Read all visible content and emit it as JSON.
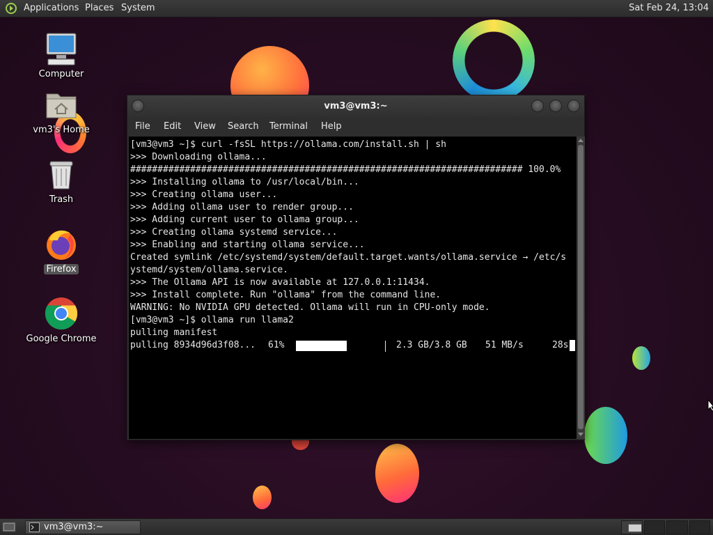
{
  "top_panel": {
    "menus": [
      "Applications",
      "Places",
      "System"
    ],
    "clock": "Sat Feb 24, 13:04"
  },
  "desktop_icons": [
    {
      "label": "Computer",
      "icon": "computer-icon"
    },
    {
      "label": "vm3's Home",
      "icon": "home-folder-icon"
    },
    {
      "label": "Trash",
      "icon": "trash-icon"
    },
    {
      "label": "Firefox",
      "icon": "firefox-icon"
    },
    {
      "label": "Google Chrome",
      "icon": "chrome-icon"
    }
  ],
  "terminal": {
    "title": "vm3@vm3:~",
    "menus": [
      "File",
      "Edit",
      "View",
      "Search",
      "Terminal",
      "Help"
    ],
    "lines": [
      "[vm3@vm3 ~]$ curl -fsSL https://ollama.com/install.sh | sh",
      ">>> Downloading ollama...",
      "######################################################################## 100.0%",
      ">>> Installing ollama to /usr/local/bin...",
      ">>> Creating ollama user...",
      ">>> Adding ollama user to render group...",
      ">>> Adding current user to ollama group...",
      ">>> Creating ollama systemd service...",
      ">>> Enabling and starting ollama service...",
      "Created symlink /etc/systemd/system/default.target.wants/ollama.service → /etc/s",
      "ystemd/system/ollama.service.",
      ">>> The Ollama API is now available at 127.0.0.1:11434.",
      ">>> Install complete. Run \"ollama\" from the command line.",
      "WARNING: No NVIDIA GPU detected. Ollama will run in CPU-only mode.",
      "[vm3@vm3 ~]$ ollama run llama2",
      "pulling manifest"
    ],
    "progress": {
      "prefix": "pulling 8934d96d3f08...",
      "percent_text": "61%",
      "fraction": 0.57,
      "size": "2.3 GB/3.8 GB",
      "speed": "51 MB/s",
      "eta": "28s"
    }
  },
  "taskbar": {
    "window_button": "vm3@vm3:~"
  },
  "colors": {
    "desktop_bg": "#2a0f24",
    "terminal_bg": "#000000",
    "terminal_fg": "#e6e6e6",
    "panel_bg": "#333333"
  }
}
